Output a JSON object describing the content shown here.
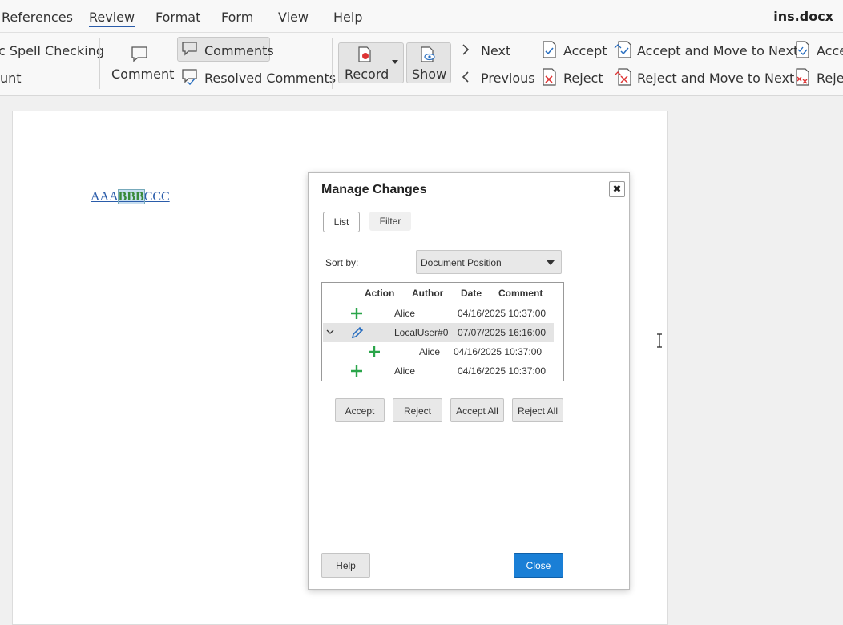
{
  "menubar": {
    "items": [
      "References",
      "Review",
      "Format",
      "Form",
      "View",
      "Help"
    ],
    "active": "Review",
    "doc_title": "ins.docx"
  },
  "ribbon": {
    "spell_check": "c Spell Checking",
    "word_count": "unt",
    "comment": "Comment",
    "comments": "Comments",
    "resolved_comments": "Resolved Comments",
    "record": "Record",
    "show": "Show",
    "next": "Next",
    "previous": "Previous",
    "accept": "Accept",
    "reject": "Reject",
    "accept_move_next": "Accept and Move to Next",
    "reject_move_next": "Reject and Move to Next",
    "accept_all_trunc": "Acce",
    "reject_all_trunc": "Rejec"
  },
  "document": {
    "text_before": "AAA",
    "text_highlight": "BBB",
    "text_after": "CCC"
  },
  "dialog": {
    "title": "Manage Changes",
    "close_glyph": "✖",
    "tabs": [
      "List",
      "Filter"
    ],
    "sort_label": "Sort by:",
    "sort_value": "Document Position",
    "columns": [
      "Action",
      "Author",
      "Date",
      "Comment"
    ],
    "rows": [
      {
        "action": "insert",
        "author": "Alice",
        "date": "04/16/2025 10:37:00",
        "comment": ""
      },
      {
        "action": "edit",
        "author": "LocalUser#0",
        "date": "07/07/2025 16:16:00",
        "comment": "",
        "expanded": true
      },
      {
        "action": "insert",
        "author": "Alice",
        "date": "04/16/2025 10:37:00",
        "comment": ""
      },
      {
        "action": "insert",
        "author": "Alice",
        "date": "04/16/2025 10:37:00",
        "comment": ""
      }
    ],
    "buttons": {
      "accept": "Accept",
      "reject": "Reject",
      "accept_all": "Accept All",
      "reject_all": "Reject All",
      "help": "Help",
      "close": "Close"
    }
  },
  "colors": {
    "insert_icon": "#2aa54a",
    "edit_icon": "#2a6fc0",
    "primary_button": "#1a7fd6",
    "link_text": "#2a5caa"
  }
}
